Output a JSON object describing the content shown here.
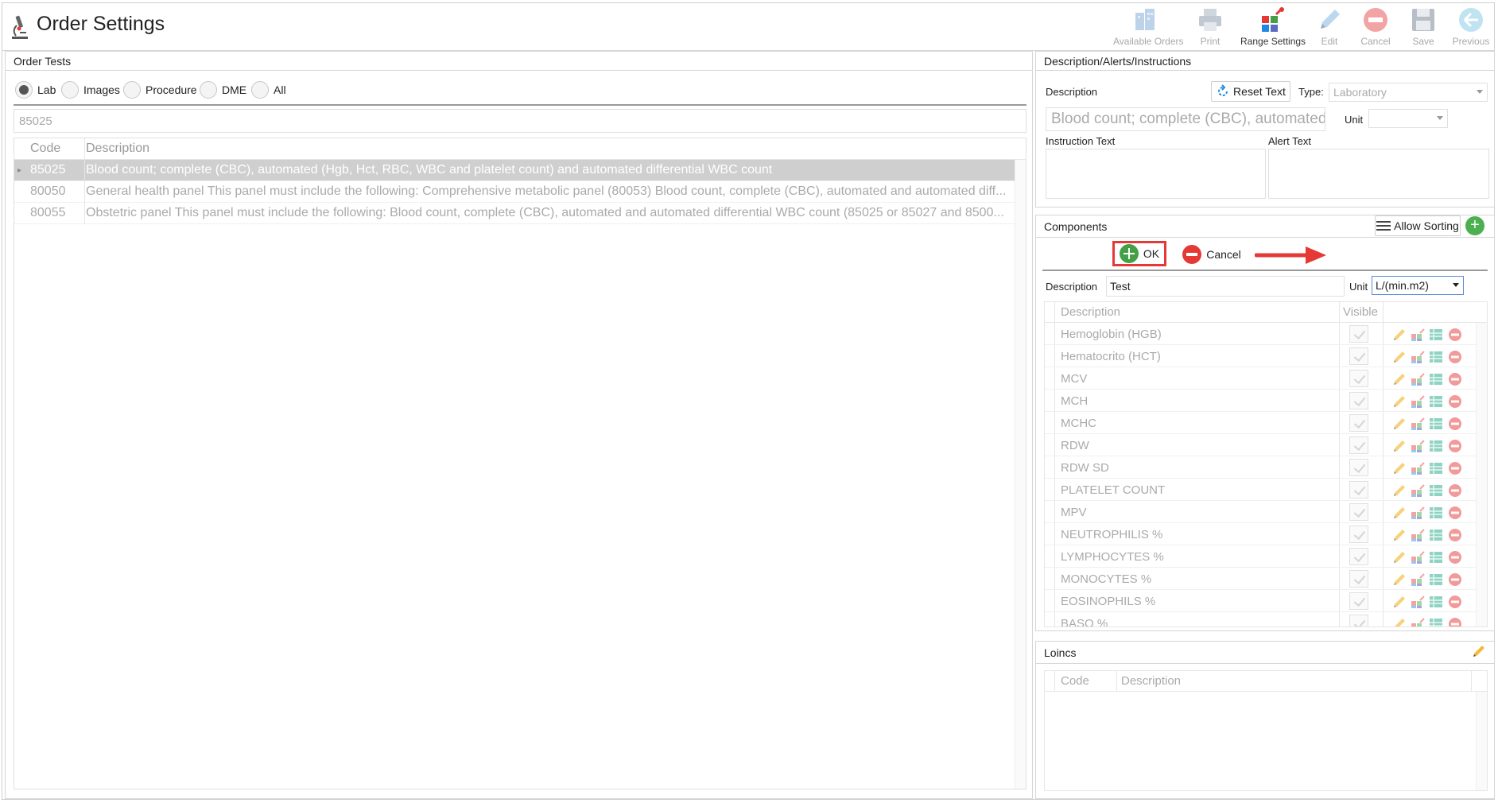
{
  "header": {
    "title": "Order Settings",
    "toolbar": [
      {
        "label": "Available Orders",
        "icon": "available-orders-icon",
        "enabled": false
      },
      {
        "label": "Print",
        "icon": "print-icon",
        "enabled": false
      },
      {
        "label": "Range Settings",
        "icon": "range-settings-icon",
        "enabled": true
      },
      {
        "label": "Edit",
        "icon": "edit-icon",
        "enabled": false
      },
      {
        "label": "Cancel",
        "icon": "cancel-icon",
        "enabled": false
      },
      {
        "label": "Save",
        "icon": "save-icon",
        "enabled": false
      },
      {
        "label": "Previous",
        "icon": "previous-icon",
        "enabled": false
      }
    ]
  },
  "order_tests": {
    "title": "Order Tests",
    "filters": [
      {
        "label": "Lab",
        "selected": true
      },
      {
        "label": "Images",
        "selected": false
      },
      {
        "label": "Procedure",
        "selected": false
      },
      {
        "label": "DME",
        "selected": false
      },
      {
        "label": "All",
        "selected": false
      }
    ],
    "search_value": "85025",
    "columns": {
      "code": "Code",
      "description": "Description"
    },
    "rows": [
      {
        "code": "85025",
        "description": "Blood count; complete (CBC), automated (Hgb, Hct, RBC, WBC and platelet count) and automated differential WBC count",
        "selected": true
      },
      {
        "code": "80050",
        "description": "General health panel This panel must include the following: Comprehensive metabolic panel (80053) Blood count, complete (CBC), automated and automated diff...",
        "selected": false
      },
      {
        "code": "80055",
        "description": "Obstetric panel This panel must include the following: Blood count, complete (CBC), automated and automated differential WBC count (85025 or 85027 and 8500...",
        "selected": false
      }
    ]
  },
  "description_panel": {
    "title": "Description/Alerts/Instructions",
    "description_label": "Description",
    "reset_label": "Reset Text",
    "type_label": "Type:",
    "type_value": "Laboratory",
    "description_value": "Blood count; complete (CBC), automated (H",
    "unit_label": "Unit",
    "unit_value": "",
    "instruction_label": "Instruction Text",
    "alert_label": "Alert Text"
  },
  "components": {
    "title": "Components",
    "allow_sorting_label": "Allow Sorting",
    "ok_label": "OK",
    "cancel_label": "Cancel",
    "description_label": "Description",
    "description_value": "Test",
    "unit_label": "Unit",
    "unit_value": "L/(min.m2)",
    "columns": {
      "description": "Description",
      "visible": "Visible"
    },
    "rows": [
      {
        "description": "Hemoglobin (HGB)",
        "visible": true
      },
      {
        "description": "Hematocrito (HCT)",
        "visible": true
      },
      {
        "description": "MCV",
        "visible": true
      },
      {
        "description": "MCH",
        "visible": true
      },
      {
        "description": "MCHC",
        "visible": true
      },
      {
        "description": "RDW",
        "visible": true
      },
      {
        "description": "RDW SD",
        "visible": true
      },
      {
        "description": "PLATELET COUNT",
        "visible": true
      },
      {
        "description": "MPV",
        "visible": true
      },
      {
        "description": "NEUTROPHILIS %",
        "visible": true
      },
      {
        "description": "LYMPHOCYTES %",
        "visible": true
      },
      {
        "description": "MONOCYTES %",
        "visible": true
      },
      {
        "description": "EOSINOPHILS %",
        "visible": true
      },
      {
        "description": "BASO %",
        "visible": true
      }
    ]
  },
  "loincs": {
    "title": "Loincs",
    "columns": {
      "code": "Code",
      "description": "Description"
    }
  },
  "colors": {
    "accent_red": "#e53935",
    "accent_green": "#43a047",
    "selected_row": "#cfcfcf"
  }
}
